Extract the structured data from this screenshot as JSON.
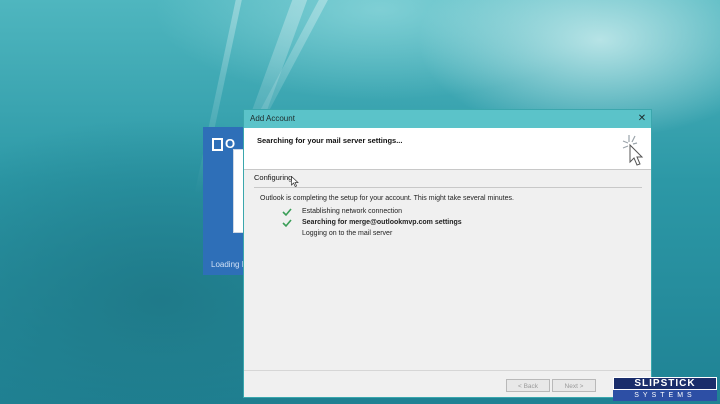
{
  "splash": {
    "logo_text": "O",
    "loading_text": "Loading P"
  },
  "dialog": {
    "title": "Add Account",
    "close_glyph": "✕",
    "header_title": "Searching for your mail server settings...",
    "section_label": "Configuring",
    "info_text": "Outlook is completing the setup for your account. This might take several minutes.",
    "steps": [
      {
        "label": "Establishing network connection",
        "status": "done"
      },
      {
        "label": "Searching for merge@outlookmvp.com settings",
        "status": "done"
      },
      {
        "label": "Logging on to the mail server",
        "status": "pending"
      }
    ],
    "buttons": {
      "back": "< Back",
      "next": "Next >"
    }
  },
  "watermark": {
    "top": "SLIPSTICK",
    "bottom": "SYSTEMS"
  },
  "colors": {
    "titlebar": "#5bc3c9",
    "check": "#3a9e57",
    "splash": "#2e6fb8"
  }
}
